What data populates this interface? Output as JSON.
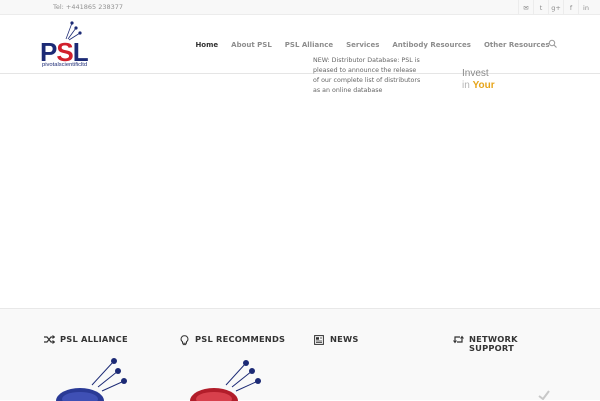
{
  "topbar": {
    "tel": "Tel: +441865 238377",
    "social": [
      {
        "icon": "mail-icon",
        "glyph": "✉"
      },
      {
        "icon": "twitter-icon",
        "glyph": "t"
      },
      {
        "icon": "google-plus-icon",
        "glyph": "g+"
      },
      {
        "icon": "facebook-icon",
        "glyph": "f"
      },
      {
        "icon": "linkedin-icon",
        "glyph": "in"
      }
    ]
  },
  "logo": {
    "text_p": "P",
    "text_s": "S",
    "text_l": "L",
    "subtitle": "pivotalscientificltd"
  },
  "nav": {
    "items": [
      {
        "label": "Home",
        "active": true
      },
      {
        "label": "About PSL",
        "active": false
      },
      {
        "label": "PSL Alliance",
        "active": false
      },
      {
        "label": "Services",
        "active": false
      },
      {
        "label": "Antibody Resources",
        "active": false
      },
      {
        "label": "Other Resources",
        "active": false
      }
    ]
  },
  "footer": {
    "alliance_title": "PSL ALLIANCE",
    "recommends_title": "PSL RECOMMENDS",
    "news_title": "NEWS",
    "network_title_1": "NETWORK",
    "network_title_2": "SUPPORT",
    "news_text": "NEW: Distributor Database: PSL is pleased to announce the release of our complete list of distributors as an online database",
    "invest_1": "Invest",
    "invest_2_pre": "in",
    "invest_2_post": "Your"
  },
  "colors": {
    "brand_blue": "#1c2a75",
    "brand_red": "#d1202c",
    "accent_yellow": "#e6a51b"
  }
}
